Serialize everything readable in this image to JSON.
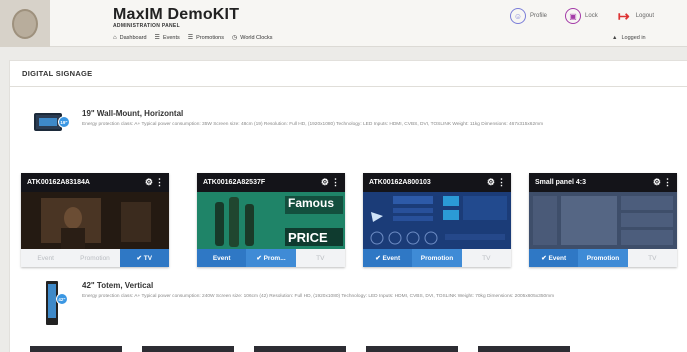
{
  "header": {
    "title": "MaxIM DemoKIT",
    "subtitle": "ADMINISTRATION PANEL",
    "nav": [
      {
        "icon": "home-icon",
        "glyph": "⌂",
        "label": "Dashboard"
      },
      {
        "icon": "events-icon",
        "glyph": "☰",
        "label": "Events"
      },
      {
        "icon": "promotions-icon",
        "glyph": "☰",
        "label": "Promotions"
      },
      {
        "icon": "clock-icon",
        "glyph": "◷",
        "label": "World Clocks"
      }
    ],
    "actions": {
      "profile": "Profile",
      "lock": "Lock",
      "logout": "Logout"
    },
    "logged_in": "Logged in"
  },
  "page": {
    "section_title": "DIGITAL SIGNAGE"
  },
  "devices": [
    {
      "title": "19\" Wall-Mount, Horizontal",
      "badge": "19\"",
      "description": "Energy protection class: A+ Typical power consumption: 35W Screen size: 48cm (19) Resolution: Full HD, (1920x1080) Technology: LED Inputs: HDMI, CVBS, DVI, TOSLINK Weight: 11kg Dimensions: 467x315x62mm"
    },
    {
      "title": "42\" Totem, Vertical",
      "badge": "42\"",
      "description": "Energy protection class: A+ Typical power consumption: 240W Screen size: 106cm (42) Resolution: Full HD, (1920x1080) Technology: LED Inputs: HDMI, CVBS, DVI, TOSLINK Weight: 70kg Dimensions: 2005x605x350mm"
    }
  ],
  "cards": [
    {
      "id": "ATK00162A83184A",
      "preview": "dark",
      "tabs": [
        {
          "label": "Event",
          "active": false
        },
        {
          "label": "Promotion",
          "active": false
        },
        {
          "label": "✔ TV",
          "active": true
        }
      ]
    },
    {
      "id": "ATK00162A82537F",
      "preview": "green",
      "promo_lines": [
        "Famous",
        "PRICE"
      ],
      "tabs": [
        {
          "label": "Event",
          "active": true
        },
        {
          "label": "✔ Prom...",
          "active": true
        },
        {
          "label": "TV",
          "active": false
        }
      ]
    },
    {
      "id": "ATK00162A800103",
      "preview": "navy",
      "tabs": [
        {
          "label": "✔ Event",
          "active": true
        },
        {
          "label": "Promotion",
          "active": true
        },
        {
          "label": "TV",
          "active": false
        }
      ]
    },
    {
      "id": "Small panel 4:3",
      "preview": "grey",
      "tabs": [
        {
          "label": "✔ Event",
          "active": true
        },
        {
          "label": "Promotion",
          "active": true
        },
        {
          "label": "TV",
          "active": false
        }
      ]
    }
  ],
  "colors": {
    "accent_blue": "#2f78c5",
    "card_header": "#141419",
    "tab_inactive_text": "#b9bcc1"
  }
}
